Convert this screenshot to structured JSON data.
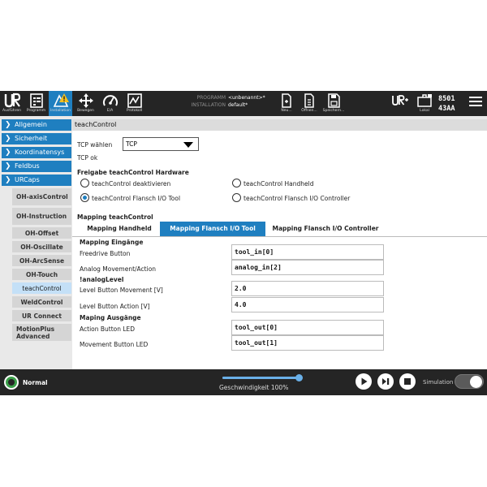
{
  "topbar": {
    "ausfuehren": "Ausführen",
    "programm": "Programm",
    "installation": "Installation",
    "bewegen": "Bewegen",
    "ea": "E/A",
    "protokoll": "Protokoll",
    "prog_key": "PROGRAMM",
    "prog_val": "<unbenannt>*",
    "inst_key": "INSTALLATION",
    "inst_val": "default*",
    "neu": "Neu...",
    "oeffnen": "Öffnen...",
    "speichern": "Speichern...",
    "lokal": "Lokal",
    "serial_1": "8501",
    "serial_2": "43AA"
  },
  "sidebar": {
    "categories": [
      "Allgemein",
      "Sicherheit",
      "Koordinatensys",
      "Feldbus",
      "URCaps"
    ],
    "urcaps": [
      "OH-axisControl",
      "OH-Instruction",
      "OH-Offset",
      "OH-Oscillate",
      "OH-ArcSense",
      "OH-Touch",
      "teachControl",
      "WeldControl",
      "UR Connect",
      "MotionPlus Advanced"
    ]
  },
  "main": {
    "title": "teachControl",
    "tcp_label": "TCP wählen",
    "tcp_value": "TCP",
    "tcp_ok": "TCP ok",
    "hardware_heading": "Freigabe teachControl Hardware",
    "radio_deaktivieren": "teachControl deaktivieren",
    "radio_handheld": "teachControl Handheld",
    "radio_flansch": "teachControl Flansch I/O Tool",
    "radio_controller": "teachControl Flansch I/O Controller",
    "mapping_heading": "Mapping teachControl",
    "tabs": [
      "Mapping Handheld",
      "Mapping Flansch I/O Tool",
      "Mapping Flansch I/O Controller"
    ],
    "eingaenge_heading": "Mapping Eingänge",
    "freedrive_label": "Freedrive Button",
    "freedrive_value": "tool_in[0]",
    "analog_label": "Analog Movement/Action",
    "analog_value": "analog_in[2]",
    "analoglevel_heading": "!analogLevel",
    "level_movement_label": "Level Button Movement [V]",
    "level_movement_value": "2.0",
    "level_action_label": "Level Button Action [V]",
    "level_action_value": "4.0",
    "ausgaenge_heading": "Maping Ausgänge",
    "action_led_label": "Action Button LED",
    "action_led_value": "tool_out[0]",
    "movement_led_label": "Movement Button LED",
    "movement_led_value": "tool_out[1]"
  },
  "bottombar": {
    "status": "Normal",
    "speed_label": "Geschwindigkeit 100%",
    "speed_fraction": 1.0,
    "simulation": "Simulation"
  },
  "colors": {
    "accent": "#1f7fc0",
    "status_ok": "#3ca04a",
    "bar_bg": "#252525"
  }
}
